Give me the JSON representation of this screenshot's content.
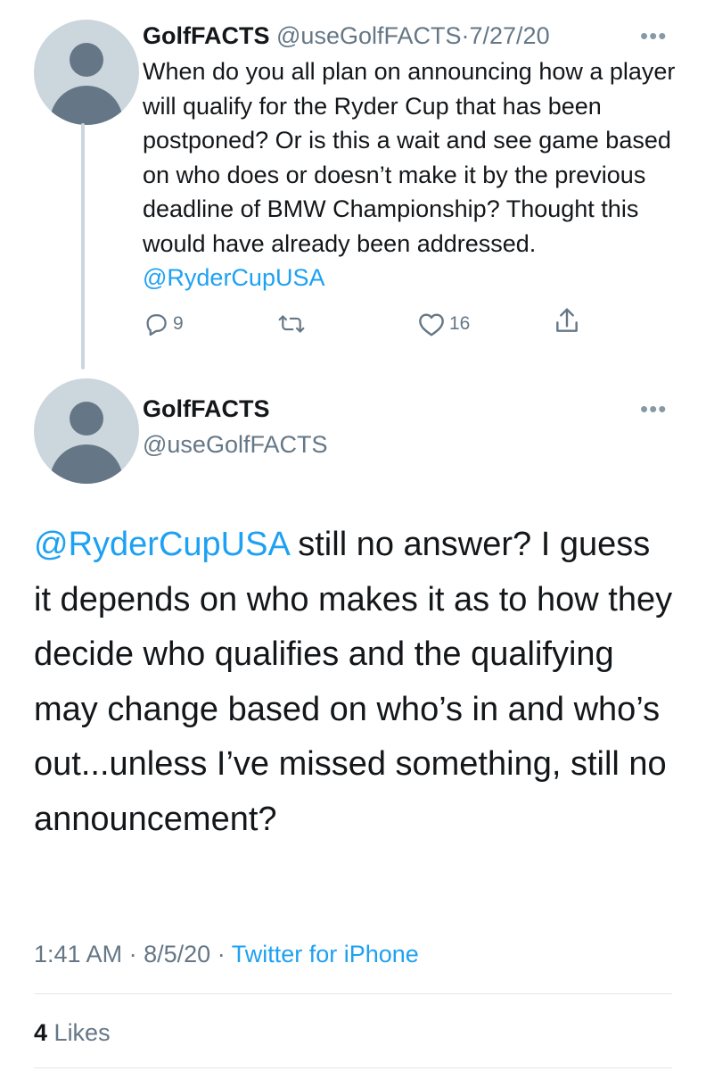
{
  "parent_tweet": {
    "display_name": "GolfFACTS",
    "handle": "@useGolfFACTS",
    "separator": "·",
    "date": "7/27/20",
    "text": "When do you all plan on announcing how a player will qualify for the Ryder Cup that has been postponed? Or is this a wait and see game based on who does or doesn’t make it by the previous deadline of BMW Championship? Thought this would have already been addressed.",
    "mention": "@RyderCupUSA",
    "reply_count": "9",
    "like_count": "16",
    "icons": [
      "reply-icon",
      "retweet-icon",
      "like-icon",
      "share-icon",
      "more-icon"
    ]
  },
  "main_tweet": {
    "display_name": "GolfFACTS",
    "handle": "@useGolfFACTS",
    "mention": "@RyderCupUSA",
    "text": "still no answer? I guess it depends on who makes it as to how they decide who qualifies and the qualifying may change based on who’s in and who’s out...unless I’ve missed something, still no announcement?",
    "time": "1:41 AM",
    "separator": "·",
    "date": "8/5/20",
    "source": "Twitter for iPhone",
    "likes_count": "4",
    "likes_label": "Likes"
  },
  "colors": {
    "accent": "#1da1f2",
    "secondary_text": "#657786",
    "primary_text": "#14171a",
    "avatar_bg": "#ccd6dd",
    "avatar_fg": "#657786",
    "divider": "#e1e8ed"
  }
}
